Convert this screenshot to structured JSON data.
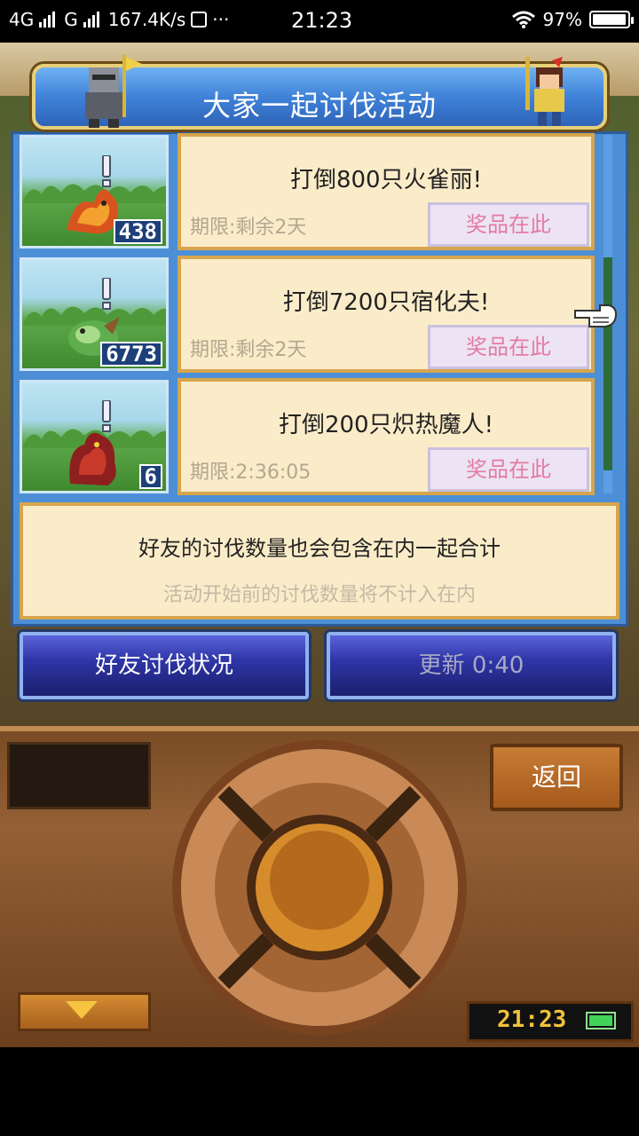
{
  "status_bar": {
    "network_1": "4G",
    "network_2": "G",
    "speed": "167.4K/s",
    "more": "···",
    "time": "21:23",
    "battery_percent": "97%",
    "battery_level": 0.97
  },
  "dialog": {
    "title": "大家一起讨伐活动",
    "missions": [
      {
        "title": "打倒800只火雀丽!",
        "deadline": "期限:剩余2天",
        "prize_label": "奖品在此",
        "count": "438"
      },
      {
        "title": "打倒7200只宿化夫!",
        "deadline": "期限:剩余2天",
        "prize_label": "奖品在此",
        "count": "6773"
      },
      {
        "title": "打倒200只炽热魔人!",
        "deadline": "期限:2:36:05",
        "prize_label": "奖品在此",
        "count": "6"
      }
    ],
    "info_main": "好友的讨伐数量也会包含在内一起合计",
    "info_sub": "活动开始前的讨伐数量将不计入在内"
  },
  "buttons": {
    "friend_status": "好友讨伐状况",
    "update": "更新 0:40",
    "back": "返回"
  },
  "console": {
    "clock": "21:23"
  },
  "colors": {
    "panel_blue": "#4d8fd6",
    "card_bg": "#fbecc9",
    "prize_text": "#e57aa4",
    "clock_text": "#f1c23a"
  }
}
